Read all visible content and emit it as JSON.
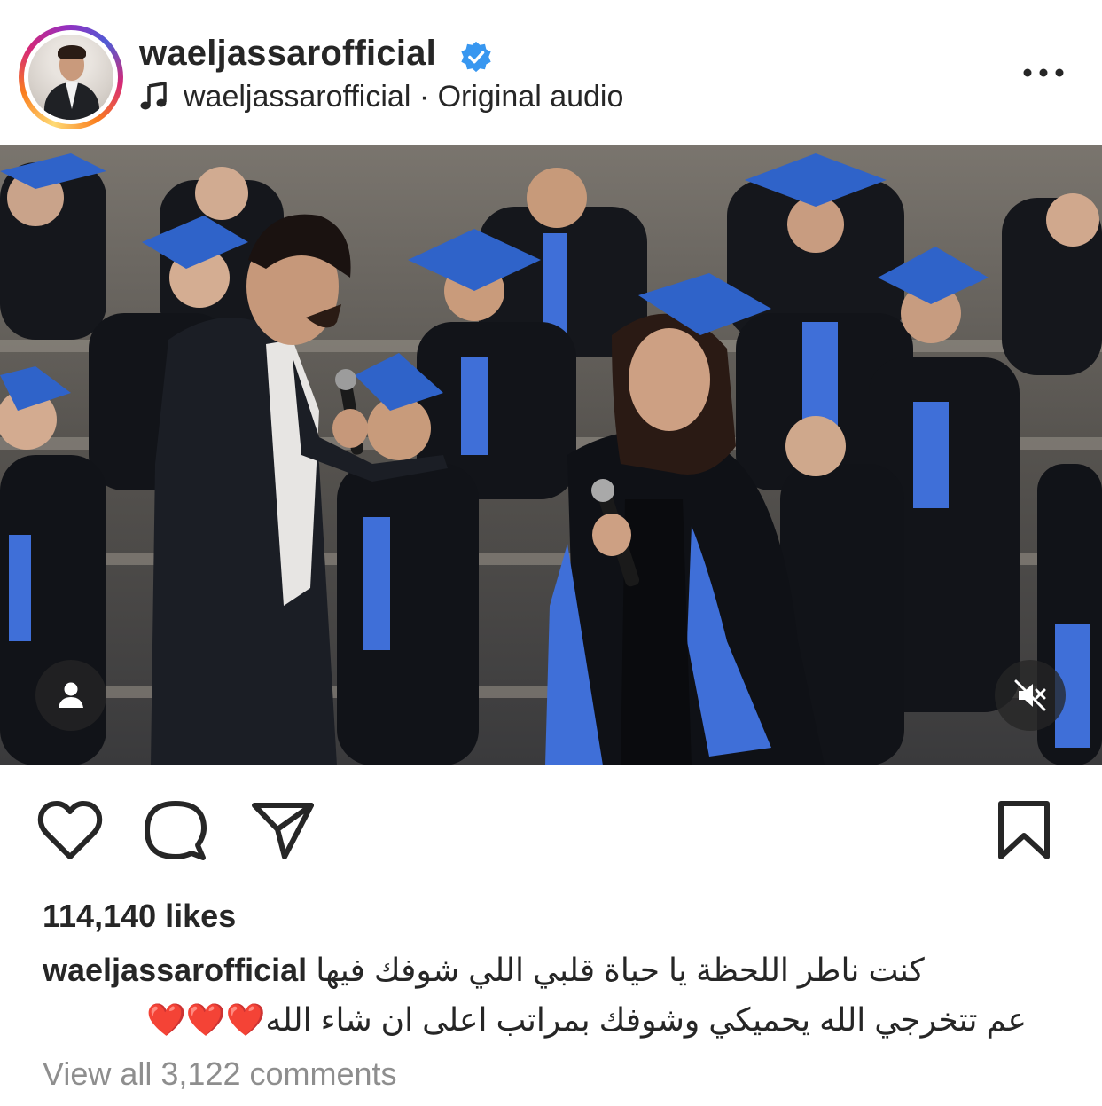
{
  "post": {
    "username": "waeljassarofficial",
    "verified": true,
    "audio": {
      "icon": "music-note-icon",
      "label": "waeljassarofficial · Original audio"
    },
    "more_icon": "more-horizontal-icon"
  },
  "media": {
    "tag_icon": "person-tag-icon",
    "mute_icon": "speaker-muted-icon"
  },
  "actions": {
    "like_icon": "heart-icon",
    "comment_icon": "comment-bubble-icon",
    "share_icon": "paper-plane-icon",
    "save_icon": "bookmark-icon"
  },
  "likes_text": "114,140 likes",
  "caption": {
    "username": "waeljassarofficial",
    "line1": "كنت ناطر اللحظة يا حياة قلبي اللي شوفك فيها",
    "line2": "عم تتخرجي الله يحميكي وشوفك  بمراتب اعلى ان شاء الله",
    "hearts": "❤️❤️❤️"
  },
  "view_comments": "View all 3,122 comments",
  "colors": {
    "text": "#262626",
    "muted": "#8e8e8e",
    "verified_blue": "#3897f0",
    "gown_blue": "#3f6fd8"
  }
}
